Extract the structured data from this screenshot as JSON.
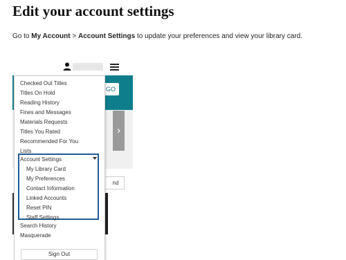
{
  "heading": "Edit your account settings",
  "intro": {
    "prefix": "Go to ",
    "my_account": "My Account",
    "separator": " > ",
    "account_settings": "Account Settings",
    "suffix": " to update your preferences and view your library card."
  },
  "header": {
    "user_icon": "user-icon",
    "menu_icon": "hamburger-menu-icon"
  },
  "search": {
    "go_label": "GO"
  },
  "carousel": {
    "next_glyph": "›"
  },
  "partial_button_label": "nd",
  "menu": {
    "items": [
      "Checked Out Titles",
      "Titles On Hold",
      "Reading History",
      "Fines and Messages",
      "Materials Requests",
      "Titles You Rated",
      "Recommended For You",
      "Lists"
    ],
    "account_settings": {
      "label": "Account Settings",
      "expanded": true,
      "subitems": [
        "My Library Card",
        "My Preferences",
        "Contact Information",
        "Linked Accounts",
        "Reset PIN",
        "Staff Settings"
      ]
    },
    "after_items": [
      "Search History",
      "Masquerade"
    ],
    "sign_out": "Sign Out"
  },
  "colors": {
    "teal": "#0f7e8c",
    "highlight_border": "#1f5a96"
  }
}
